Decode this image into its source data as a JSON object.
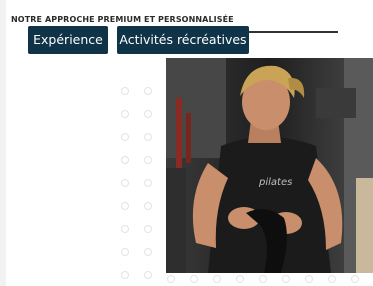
{
  "section": {
    "kicker": "NOTRE APPROCHE PREMIUM ET PERSONNALISÉE"
  },
  "tabs": [
    {
      "label": "Expérience"
    },
    {
      "label": "Activités récréatives"
    }
  ],
  "photo": {
    "shirt_text": "pilates",
    "colors": {
      "background": "#2a2a2a",
      "shirt": "#1b1b1b",
      "skin": "#c98e6c",
      "hair": "#c9a456"
    }
  },
  "colors": {
    "button_bg": "#0f3448",
    "button_text": "#ffffff",
    "dot_border": "#e3e3e3"
  }
}
